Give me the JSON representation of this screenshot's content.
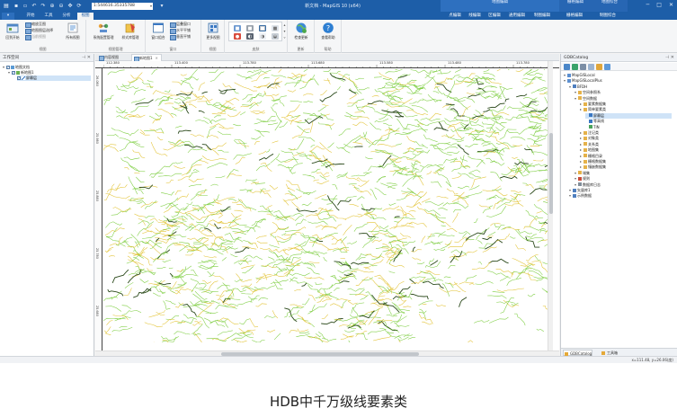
{
  "titlebar": {
    "scale_value": "1:544616.35335788",
    "app_title": "新文档 - MapGIS 10 (x64)",
    "context_groups": [
      {
        "label": "地图编辑",
        "color": "#2e70bf"
      },
      {
        "label": "栅格编辑",
        "color": "#2a66b0"
      },
      {
        "label": "地图综合",
        "color": "#2a66b0"
      }
    ],
    "window_controls": [
      "─",
      "□",
      "✕"
    ]
  },
  "tabs": [
    {
      "label": "开始",
      "active": false
    },
    {
      "label": "工具",
      "active": false
    },
    {
      "label": "分析",
      "active": false
    },
    {
      "label": "视图",
      "active": true
    },
    {
      "label": "点编辑",
      "active": false
    },
    {
      "label": "线编辑",
      "active": false
    },
    {
      "label": "区编辑",
      "active": false
    },
    {
      "label": "通用编辑",
      "active": false
    },
    {
      "label": "制图编辑",
      "active": false
    },
    {
      "label": "栅格编辑",
      "active": false
    },
    {
      "label": "制图综合",
      "active": false
    }
  ],
  "ribbon": {
    "groups": [
      {
        "label": "视图",
        "big": [
          "回到开始"
        ],
        "small": [
          "缩放至图",
          "地图图层选择",
          "当前视图"
        ]
      },
      {
        "label": "视图管理",
        "big": [
          "所有视图",
          "系统配置管理",
          "样式库管理"
        ],
        "small": []
      },
      {
        "label": "窗口",
        "big": [
          "窗口组合"
        ],
        "small": [
          "层叠窗口",
          "水平平铺",
          "垂直平铺"
        ]
      },
      {
        "label": "视图",
        "big": [
          "更多视图"
        ],
        "small": []
      },
      {
        "label": "皮肤",
        "big": [],
        "small": []
      },
      {
        "label": "更新",
        "big": [
          "检查更新"
        ],
        "small": []
      },
      {
        "label": "帮助",
        "big": [
          "查看帮助"
        ],
        "small": []
      }
    ]
  },
  "left_panel": {
    "title": "工作空间",
    "tree": [
      {
        "label": "地图文档",
        "level": 0,
        "checked": true,
        "selected": false
      },
      {
        "label": "新地图1",
        "level": 1,
        "checked": true,
        "selected": false
      },
      {
        "label": "屏幕层",
        "level": 2,
        "checked": true,
        "selected": true
      }
    ]
  },
  "doc_tabs": [
    {
      "label": "内容视图",
      "active": false
    },
    {
      "label": "新地图1",
      "active": true
    }
  ],
  "ruler_top_labels": [
    "112.380",
    "113.400",
    "113.780",
    "113.680",
    "113.580",
    "113.480",
    "113.780"
  ],
  "ruler_left_labels": [
    "26.080",
    "25.980",
    "25.880",
    "25.780",
    "25.680"
  ],
  "right_panel": {
    "title": "GDBCatalog",
    "tree": [
      {
        "label": "MapGISLocal",
        "level": 0,
        "icon": "server"
      },
      {
        "label": "MapGISLocalPlus",
        "level": 0,
        "icon": "server"
      },
      {
        "label": "BFDH",
        "level": 1,
        "icon": "db"
      },
      {
        "label": "空间参照系",
        "level": 2,
        "icon": "folder"
      },
      {
        "label": "空间数据",
        "level": 2,
        "icon": "folder"
      },
      {
        "label": "要素数据集",
        "level": 3,
        "icon": "folder"
      },
      {
        "label": "简单要素类",
        "level": 3,
        "icon": "folder"
      },
      {
        "label": "屏幕层",
        "level": 4,
        "icon": "line",
        "selected": true
      },
      {
        "label": "等高线",
        "level": 4,
        "icon": "line"
      },
      {
        "label": "TIN",
        "level": 4,
        "icon": "tin"
      },
      {
        "label": "注记类",
        "level": 3,
        "icon": "folder"
      },
      {
        "label": "对象类",
        "level": 3,
        "icon": "folder"
      },
      {
        "label": "关系类",
        "level": 3,
        "icon": "folder"
      },
      {
        "label": "地图集",
        "level": 3,
        "icon": "folder"
      },
      {
        "label": "栅格目录",
        "level": 3,
        "icon": "folder"
      },
      {
        "label": "栅格数据集",
        "level": 3,
        "icon": "folder"
      },
      {
        "label": "镶嵌数据集",
        "level": 3,
        "icon": "folder"
      },
      {
        "label": "域集",
        "level": 2,
        "icon": "folder"
      },
      {
        "label": "规则",
        "level": 2,
        "icon": "rule"
      },
      {
        "label": "数据库日志",
        "level": 2,
        "icon": "log"
      },
      {
        "label": "矢量库1",
        "level": 1,
        "icon": "db"
      },
      {
        "label": "示例数据",
        "level": 1,
        "icon": "db"
      }
    ],
    "bottom_tabs": [
      {
        "label": "GDBCatalog",
        "active": true
      },
      {
        "label": "工具箱",
        "active": false
      }
    ]
  },
  "status": {
    "coords": "x=111.48, y=26.06(度)"
  },
  "caption": "HDB中千万级线要素类",
  "colors": {
    "brand": "#1d5ea8",
    "line_green": "#7ccd3f",
    "line_yellow": "#e2c232",
    "line_dark": "#2c4a1c"
  }
}
